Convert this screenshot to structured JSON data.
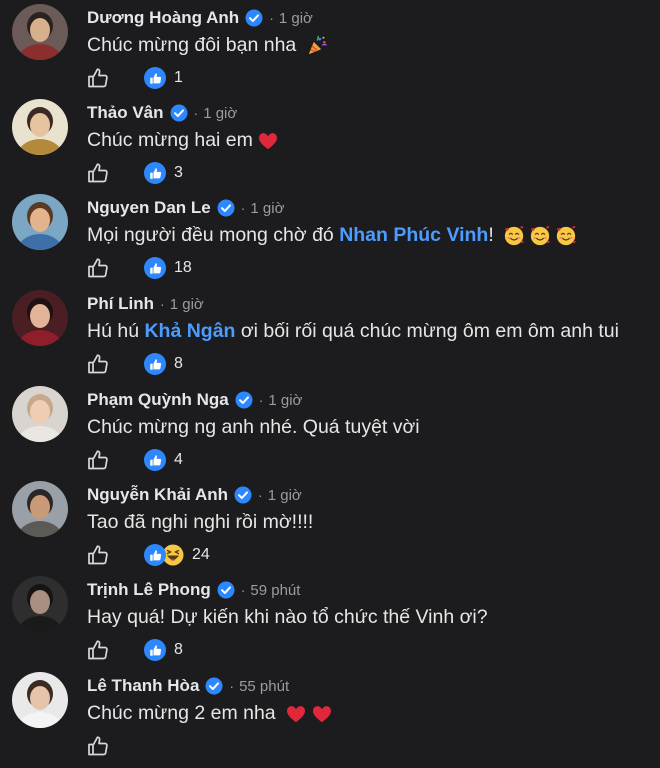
{
  "comments": [
    {
      "name": "Dương Hoàng Anh",
      "verified": true,
      "time": "1 giờ",
      "text_before": "Chúc mừng đôi bạn nha ",
      "mention": "",
      "text_after": "",
      "emoji": [
        "party-popper"
      ],
      "reactions": [
        "like"
      ],
      "count": "1",
      "avatar": {
        "bg": "#6a5a58",
        "face": "#d9b08c",
        "hair": "#2a2220",
        "body": "#8b2e2e"
      }
    },
    {
      "name": "Thảo Vân",
      "verified": true,
      "time": "1 giờ",
      "text_before": "Chúc mừng hai em",
      "mention": "",
      "text_after": "",
      "emoji": [
        "red-heart"
      ],
      "reactions": [
        "like"
      ],
      "count": "3",
      "avatar": {
        "bg": "#e8e2cf",
        "face": "#e8c3a0",
        "hair": "#3a2a25",
        "body": "#b38a3a"
      }
    },
    {
      "name": "Nguyen Dan Le",
      "verified": true,
      "time": "1 giờ",
      "text_before": "Mọi người đều mong chờ đó ",
      "mention": "Nhan Phúc Vinh",
      "text_after": "! ",
      "emoji": [
        "smiling-face-with-hearts",
        "smiling-face-with-hearts",
        "smiling-face-with-hearts"
      ],
      "reactions": [
        "like"
      ],
      "count": "18",
      "avatar": {
        "bg": "#7ba6c4",
        "face": "#e3b38e",
        "hair": "#5a3a25",
        "body": "#3f6fa8"
      }
    },
    {
      "name": "Phí Linh",
      "verified": false,
      "time": "1 giờ",
      "text_before": "Hú hú ",
      "mention": "Khả Ngân",
      "text_after": " ơi bối rối quá chúc mừng ôm em ôm anh tui",
      "emoji": [],
      "reactions": [
        "like"
      ],
      "count": "8",
      "avatar": {
        "bg": "#4a1e22",
        "face": "#e2b497",
        "hair": "#1e1112",
        "body": "#8e1f2a"
      }
    },
    {
      "name": "Phạm Quỳnh Nga",
      "verified": true,
      "time": "1 giờ",
      "text_before": "Chúc mừng ng anh nhé. Quá tuyệt vời",
      "mention": "",
      "text_after": "",
      "emoji": [],
      "reactions": [
        "like"
      ],
      "count": "4",
      "avatar": {
        "bg": "#d8d4cf",
        "face": "#efcdb4",
        "hair": "#c7a88a",
        "body": "#eae7e3"
      }
    },
    {
      "name": "Nguyễn Khải Anh",
      "verified": true,
      "time": "1 giờ",
      "text_before": "Tao đã nghi nghi rồi mờ!!!!",
      "mention": "",
      "text_after": "",
      "emoji": [],
      "reactions": [
        "like",
        "haha"
      ],
      "count": "24",
      "avatar": {
        "bg": "#9aa0a8",
        "face": "#c99a78",
        "hair": "#2b2724",
        "body": "#5c5a56"
      }
    },
    {
      "name": "Trịnh Lê Phong",
      "verified": true,
      "time": "59 phút",
      "text_before": "Hay quá! Dự kiến khi nào tổ chức thế Vinh ơi?",
      "mention": "",
      "text_after": "",
      "emoji": [],
      "reactions": [
        "like"
      ],
      "count": "8",
      "avatar": {
        "bg": "#2e2e2e",
        "face": "#a98f80",
        "hair": "#141414",
        "body": "#1a1a1a"
      }
    },
    {
      "name": "Lê Thanh Hòa",
      "verified": true,
      "time": "55 phút",
      "text_before": "Chúc mừng 2 em nha ",
      "mention": "",
      "text_after": "",
      "emoji": [
        "red-heart",
        "red-heart"
      ],
      "reactions": [],
      "count": "",
      "avatar": {
        "bg": "#e9e9e9",
        "face": "#e6c3aa",
        "hair": "#3c2b22",
        "body": "#f4f4f4"
      }
    }
  ],
  "separator": "·"
}
